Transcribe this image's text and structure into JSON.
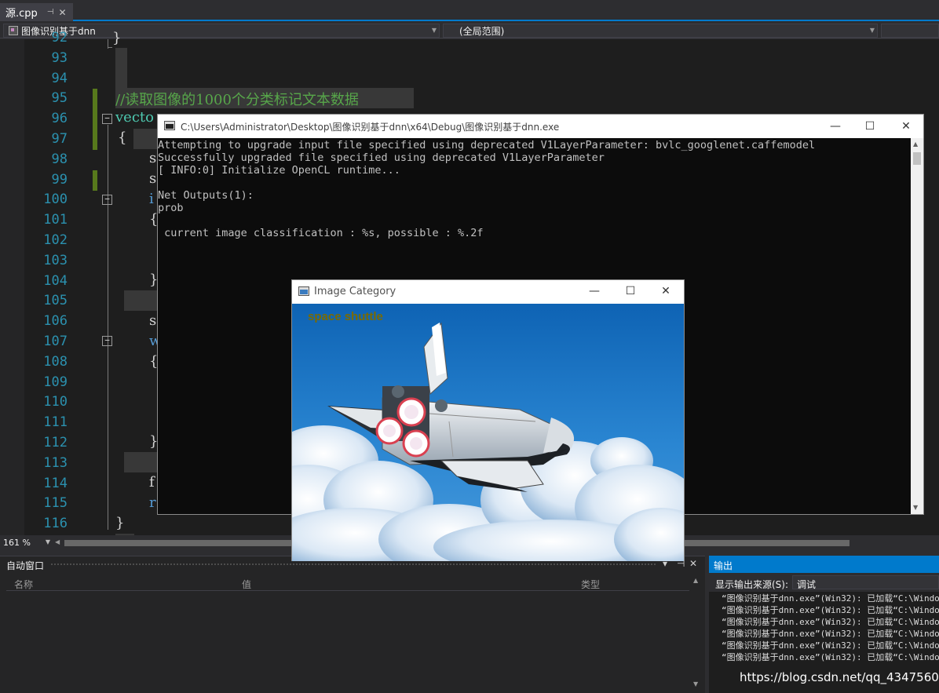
{
  "tab": {
    "name": "源.cpp",
    "pin": "⊣",
    "close": "✕"
  },
  "navbar": {
    "project": "图像识别基于dnn",
    "scope": "(全局范围)"
  },
  "editor": {
    "line_numbers": [
      "92",
      "93",
      "94",
      "95",
      "96",
      "97",
      "98",
      "99",
      "100",
      "101",
      "102",
      "103",
      "104",
      "105",
      "106",
      "107",
      "108",
      "109",
      "110",
      "111",
      "112",
      "113",
      "114",
      "115",
      "116"
    ],
    "code": {
      "l92": "}",
      "l95": "//读取图像的1000个分类标记文本数据",
      "l96": "vecto",
      "l97": "{",
      "l98": "s",
      "l99": "s",
      "l100": "i",
      "l101": "{",
      "l104": "}",
      "l106": "s",
      "l107": "w",
      "l108": "{",
      "l112": "}",
      "l114": "f",
      "l115": "r",
      "l116": "}"
    },
    "fold_symbol": "−"
  },
  "zoom": {
    "value": "161 %"
  },
  "auto_window": {
    "title": "自动窗口",
    "columns": [
      "名称",
      "值",
      "类型"
    ],
    "pin": "▾",
    "pin2": "⊣",
    "close": "✕"
  },
  "output": {
    "title": "输出",
    "source_label": "显示输出来源(S):",
    "source_value": "调试",
    "lines": [
      "“图像识别基于dnn.exe”(Win32): 已加载“C:\\Windows",
      "“图像识别基于dnn.exe”(Win32): 已加载“C:\\Windows",
      "“图像识别基于dnn.exe”(Win32): 已加载“C:\\Windows",
      "“图像识别基于dnn.exe”(Win32): 已加载“C:\\Windows",
      "“图像识别基于dnn.exe”(Win32): 已加载“C:\\Windows",
      "“图像识别基于dnn.exe”(Win32): 已加载“C:\\Windows"
    ]
  },
  "watermark": "https://blog.csdn.net/qq_43475606",
  "console": {
    "title": "C:\\Users\\Administrator\\Desktop\\图像识别基于dnn\\x64\\Debug\\图像识别基于dnn.exe",
    "lines": [
      "Attempting to upgrade input file specified using deprecated V1LayerParameter: bvlc_googlenet.caffemodel",
      "Successfully upgraded file specified using deprecated V1LayerParameter",
      "[ INFO:0] Initialize OpenCL runtime...",
      "",
      "Net Outputs(1):",
      "prob",
      "",
      " current image classification : %s, possible : %.2f"
    ],
    "buttons": {
      "minimize": "—",
      "maximize": "☐",
      "close": "✕"
    }
  },
  "image_window": {
    "title": "Image Category",
    "label": "space shuttle",
    "buttons": {
      "minimize": "—",
      "maximize": "☐",
      "close": "✕"
    }
  },
  "colors": {
    "ide_bg": "#1e1e1e",
    "accent": "#007acc",
    "line_number": "#2b91af",
    "comment": "#57a64a",
    "keyword": "#569cd6",
    "change_bar": "#57791c",
    "label_text": "#7a6a00"
  }
}
